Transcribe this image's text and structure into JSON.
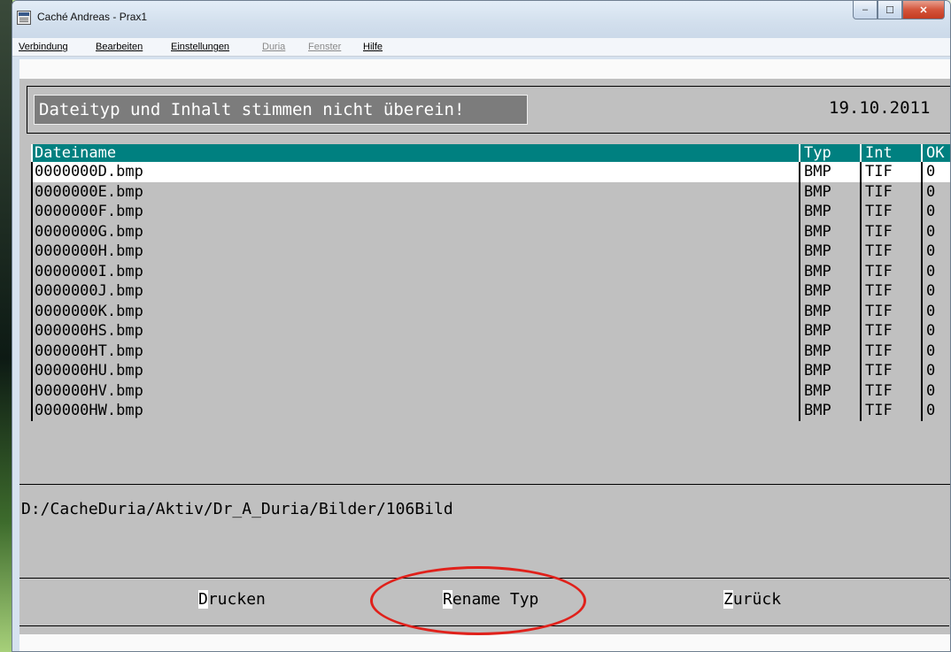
{
  "window": {
    "title": "Caché Andreas - Prax1",
    "controls": {
      "minimize": "–",
      "maximize": "☐",
      "close": "✕"
    }
  },
  "menu": {
    "items": [
      {
        "label": "Verbindung",
        "enabled": true
      },
      {
        "label": "Bearbeiten",
        "enabled": true
      },
      {
        "label": "Einstellungen",
        "enabled": true
      },
      {
        "label": "Duria",
        "enabled": false
      },
      {
        "label": "Fenster",
        "enabled": false
      },
      {
        "label": "Hilfe",
        "enabled": true
      }
    ]
  },
  "header": {
    "message": "Dateityp und Inhalt stimmen nicht überein!",
    "date": "19.10.2011"
  },
  "table": {
    "columns": [
      "Dateiname",
      "Typ",
      "Int",
      "OK"
    ],
    "rows": [
      {
        "name": "0000000D.bmp",
        "typ": "BMP",
        "int": "TIF",
        "ok": "0"
      },
      {
        "name": "0000000E.bmp",
        "typ": "BMP",
        "int": "TIF",
        "ok": "0"
      },
      {
        "name": "0000000F.bmp",
        "typ": "BMP",
        "int": "TIF",
        "ok": "0"
      },
      {
        "name": "0000000G.bmp",
        "typ": "BMP",
        "int": "TIF",
        "ok": "0"
      },
      {
        "name": "0000000H.bmp",
        "typ": "BMP",
        "int": "TIF",
        "ok": "0"
      },
      {
        "name": "0000000I.bmp",
        "typ": "BMP",
        "int": "TIF",
        "ok": "0"
      },
      {
        "name": "0000000J.bmp",
        "typ": "BMP",
        "int": "TIF",
        "ok": "0"
      },
      {
        "name": "0000000K.bmp",
        "typ": "BMP",
        "int": "TIF",
        "ok": "0"
      },
      {
        "name": "000000HS.bmp",
        "typ": "BMP",
        "int": "TIF",
        "ok": "0"
      },
      {
        "name": "000000HT.bmp",
        "typ": "BMP",
        "int": "TIF",
        "ok": "0"
      },
      {
        "name": "000000HU.bmp",
        "typ": "BMP",
        "int": "TIF",
        "ok": "0"
      },
      {
        "name": "000000HV.bmp",
        "typ": "BMP",
        "int": "TIF",
        "ok": "0"
      },
      {
        "name": "000000HW.bmp",
        "typ": "BMP",
        "int": "TIF",
        "ok": "0"
      }
    ],
    "selected_index": 0
  },
  "path": "D:/CacheDuria/Aktiv/Dr_A_Duria/Bilder/106Bild",
  "buttons": {
    "print": {
      "hotkey": "D",
      "rest": "rucken"
    },
    "rename": {
      "hotkey": "R",
      "rest": "ename Typ"
    },
    "back": {
      "hotkey": "Z",
      "rest": "urück"
    }
  },
  "edge_labels": {
    "top": "A",
    "bottom": "E"
  },
  "colors": {
    "header_teal": "#008080",
    "background_gray": "#c0c0c0",
    "annotation_red": "#e0211b"
  }
}
